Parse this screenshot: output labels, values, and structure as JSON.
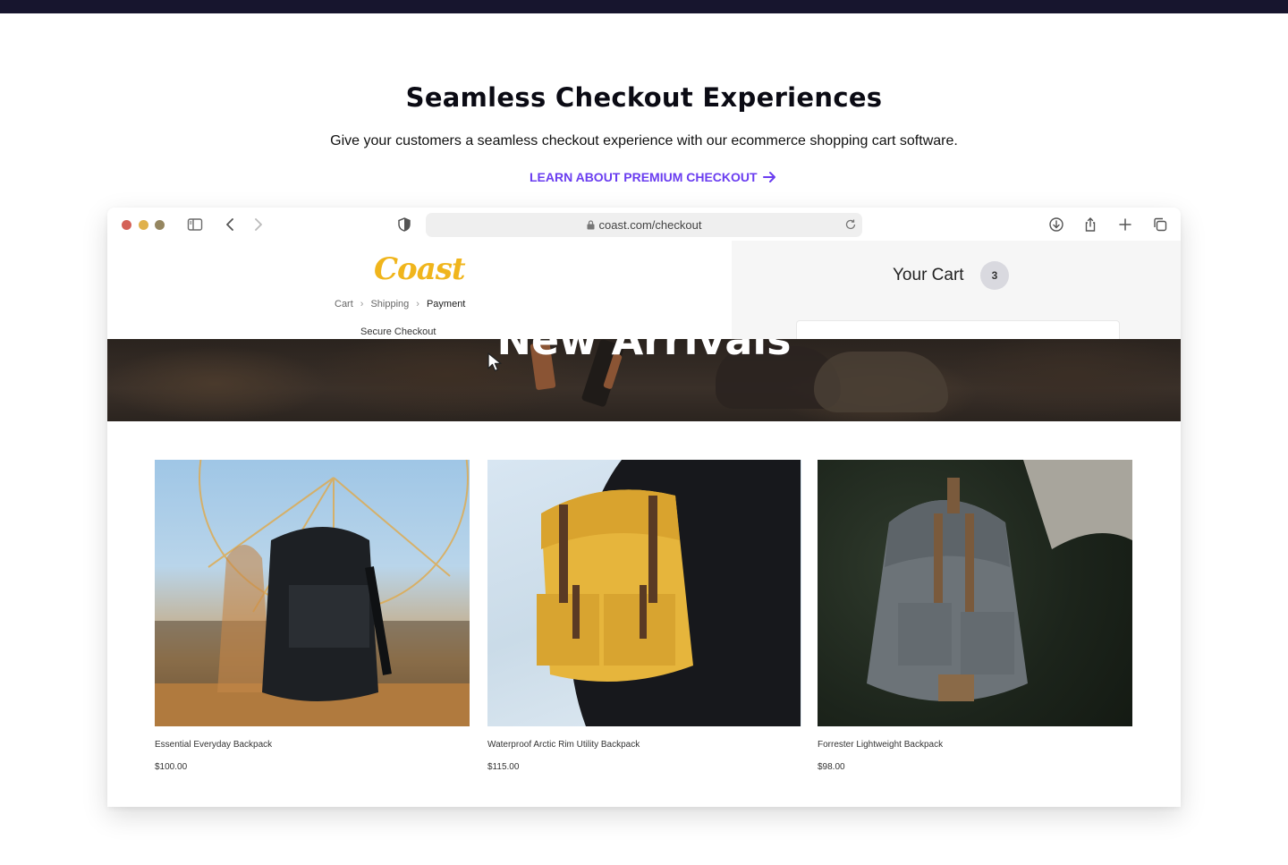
{
  "hero": {
    "title": "Seamless Checkout Experiences",
    "subtitle": "Give your customers a seamless checkout experience with our ecommerce shopping cart software.",
    "cta_label": "LEARN ABOUT PREMIUM CHECKOUT"
  },
  "browser": {
    "url": "coast.com/checkout",
    "icons": [
      "sidebar-icon",
      "back-icon",
      "forward-icon",
      "shield-icon",
      "download-icon",
      "share-icon",
      "new-tab-icon",
      "tabs-icon"
    ]
  },
  "checkout": {
    "logo": "Coast",
    "breadcrumbs": [
      "Cart",
      "Shipping",
      "Payment"
    ],
    "secure_label": "Secure Checkout",
    "cart_title": "Your Cart",
    "cart_count": "3"
  },
  "banner": {
    "headline": "New Arrivals"
  },
  "products": [
    {
      "name": "Essential Everyday Backpack",
      "price": "$100.00"
    },
    {
      "name": "Waterproof Arctic Rim Utility Backpack",
      "price": "$115.00"
    },
    {
      "name": "Forrester Lightweight Backpack",
      "price": "$98.00"
    }
  ],
  "colors": {
    "accent": "#6a3df0",
    "topbar": "#17152e",
    "logo": "#f0b51c"
  }
}
